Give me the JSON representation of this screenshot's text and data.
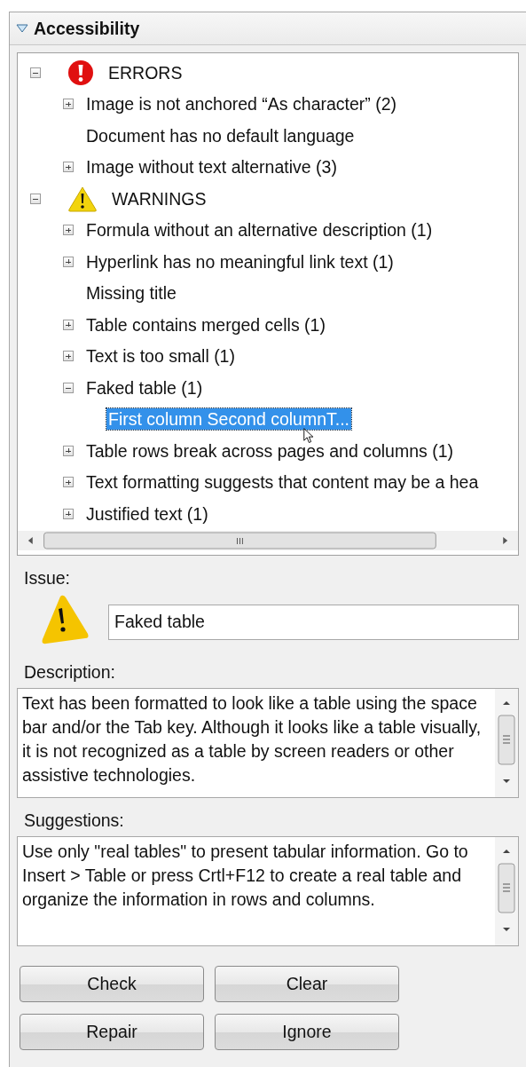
{
  "panel": {
    "title": "Accessibility",
    "expanded": true
  },
  "tree": [
    {
      "label": "ERRORS",
      "kind": "error",
      "expanded": true,
      "selected": false,
      "children": [
        {
          "label": "Image is not anchored “As character” (2)",
          "kind": "node",
          "expanded": false,
          "selected": false
        },
        {
          "label": "Document has no default language",
          "kind": "leaf",
          "selected": false
        },
        {
          "label": "Image without text alternative (3)",
          "kind": "node",
          "expanded": false,
          "selected": false
        }
      ]
    },
    {
      "label": "WARNINGS",
      "kind": "warning",
      "expanded": true,
      "selected": false,
      "children": [
        {
          "label": "Formula without an alternative description (1)",
          "kind": "node",
          "expanded": false,
          "selected": false
        },
        {
          "label": "Hyperlink has no meaningful link text (1)",
          "kind": "node",
          "expanded": false,
          "selected": false
        },
        {
          "label": "Missing title",
          "kind": "leaf",
          "selected": false
        },
        {
          "label": "Table contains merged cells (1)",
          "kind": "node",
          "expanded": false,
          "selected": false
        },
        {
          "label": "Text is too small (1)",
          "kind": "node",
          "expanded": false,
          "selected": false
        },
        {
          "label": "Faked table (1)",
          "kind": "node",
          "expanded": true,
          "selected": false,
          "children": [
            {
              "label": "First column  Second columnT...",
              "kind": "leaf",
              "selected": true
            }
          ]
        },
        {
          "label": "Table rows break across pages and columns (1)",
          "kind": "node",
          "expanded": false,
          "selected": false
        },
        {
          "label": "Text formatting suggests that content may be a hea",
          "kind": "node",
          "expanded": false,
          "selected": false
        },
        {
          "label": "Justified text (1)",
          "kind": "node",
          "expanded": false,
          "selected": false
        }
      ]
    }
  ],
  "issue": {
    "label": "Issue:",
    "kind": "warning",
    "value": "Faked table"
  },
  "description": {
    "label": "Description:",
    "text": "Text has been formatted to look like a table using the space bar and/or the Tab key. Although it looks like a table visually, it is not recognized as a table by screen readers or other assistive technologies."
  },
  "suggestions": {
    "label": "Suggestions:",
    "text": "Use only \"real tables\" to present tabular information. Go to Insert > Table or press Crtl+F12 to create a real table and organize the information in rows and columns."
  },
  "buttons": [
    [
      "Check",
      "Clear"
    ],
    [
      "Repair",
      "Ignore"
    ]
  ]
}
